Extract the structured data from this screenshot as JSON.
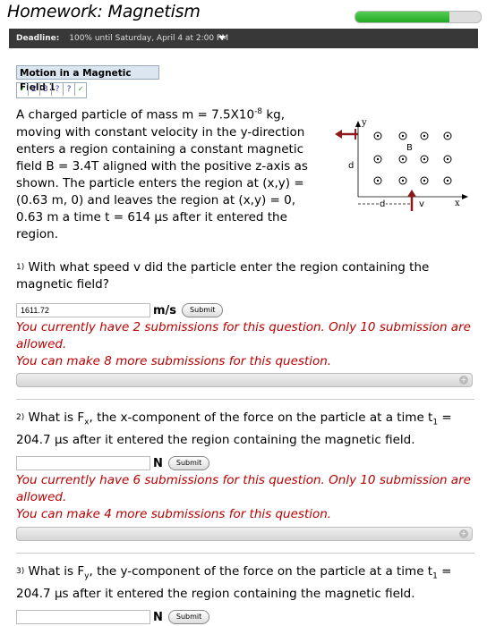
{
  "header": {
    "title": "Homework: Magnetism",
    "progress": 0.75
  },
  "deadline": {
    "label": "Deadline:",
    "text": "100% until Saturday, April 4 at 2:00 PM"
  },
  "section": {
    "title": "Motion in a Magnetic Field 1",
    "parts": [
      "✓",
      "2",
      "3",
      "?",
      "?",
      "✓"
    ]
  },
  "problem": {
    "text_a": "A charged particle of mass m = 7.5X10",
    "exp": "-8",
    "text_b": " kg, moving with constant velocity in the y-direction enters a region containing a constant magnetic field B = 3.4T aligned with the positive z-axis as shown. The particle enters the region at (x,y) = (0.63 m, 0) and leaves the region at (x,y) = 0, 0.63 m a time t = 614 μs after it entered the region."
  },
  "diagram": {
    "y_label": "y",
    "x_label": "x",
    "b_label": "B",
    "d_label": "d",
    "v_label": "v"
  },
  "q1": {
    "num": "1)",
    "text": "With what speed v did the particle enter the region containing the magnetic field?",
    "value": "1611.72",
    "unit": "m/s",
    "submit": "Submit",
    "msg1": "You currently have 2 submissions for this question. Only 10 submission are allowed.",
    "msg2": "You can make 8 more submissions for this question."
  },
  "q2": {
    "num": "2)",
    "text_a": "What is F",
    "sub": "x",
    "text_b": ", the x-component of the force on the particle at a time t",
    "sub2": "1",
    "text_c": " = 204.7 μs after it entered the region containing the magnetic field.",
    "value": "",
    "unit": "N",
    "submit": "Submit",
    "msg1": "You currently have 6 submissions for this question. Only 10 submission are allowed.",
    "msg2": "You can make 4 more submissions for this question."
  },
  "q3": {
    "num": "3)",
    "text_a": "What is F",
    "sub": "y",
    "text_b": ", the y-component of the force on the particle at a time t",
    "sub2": "1",
    "text_c": " = 204.7 μs after it entered the region containing the magnetic field.",
    "value": "",
    "unit": "N",
    "submit": "Submit"
  }
}
